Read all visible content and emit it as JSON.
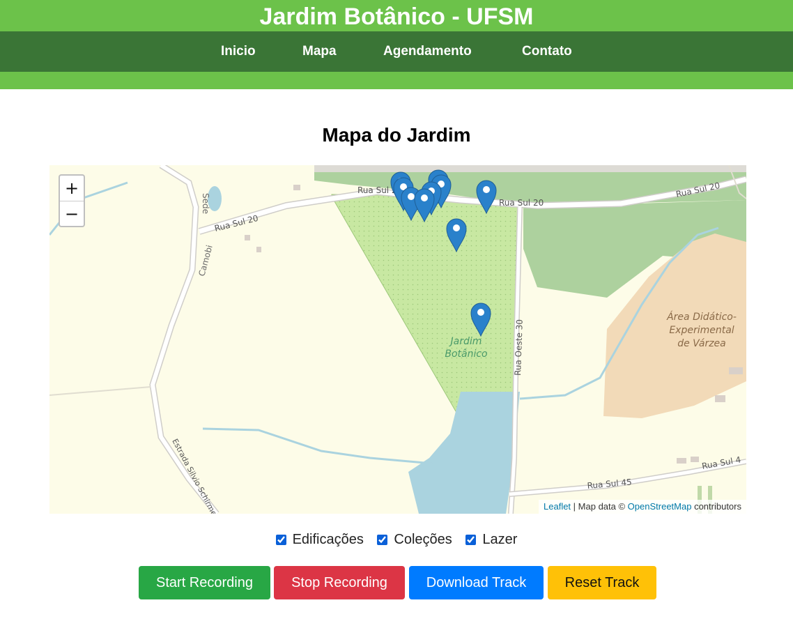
{
  "header": {
    "title": "Jardim Botânico - UFSM",
    "nav": [
      "Inicio",
      "Mapa",
      "Agendamento",
      "Contato"
    ]
  },
  "page": {
    "heading": "Mapa do Jardim"
  },
  "map": {
    "zoom_in": "+",
    "zoom_out": "−",
    "labels": {
      "rua_sul_20": "Rua Sul 20",
      "camobi": "Camobi",
      "sede": "Sede",
      "rua_oeste_30": "Rua Oeste 30",
      "estrada": "Estrada Silvio Schirmer",
      "rua_sul_45": "Rua Sul 45",
      "rua_sul_4": "Rua Sul 4",
      "jardim_line1": "Jardim",
      "jardim_line2": "Botânico",
      "area_line1": "Área Didático-",
      "area_line2": "Experimental",
      "area_line3": "de Várzea"
    },
    "attribution": {
      "leaflet": "Leaflet",
      "separator": " | Map data © ",
      "osm": "OpenStreetMap",
      "suffix": " contributors"
    },
    "marker_icon": "map-pin-icon",
    "marker_color": "#2a81cb"
  },
  "filters": [
    {
      "label": "Edificações",
      "checked": true
    },
    {
      "label": "Coleções",
      "checked": true
    },
    {
      "label": "Lazer",
      "checked": true
    }
  ],
  "buttons": {
    "start": "Start Recording",
    "stop": "Stop Recording",
    "download": "Download Track",
    "reset": "Reset Track"
  }
}
